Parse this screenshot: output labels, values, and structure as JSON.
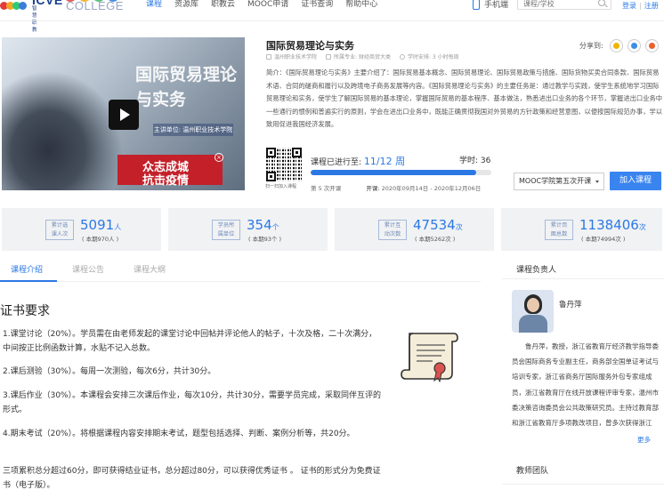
{
  "nav": {
    "logo_text": "ICVE",
    "logo_sub": "智慧职教",
    "college": "COLLEGE",
    "links": [
      "课程",
      "资源库",
      "职教云",
      "MOOC申请",
      "证书查询",
      "帮助中心"
    ],
    "mobile": "手机端",
    "search_placeholder": "课程/学校",
    "login": "登录",
    "register": "注册"
  },
  "course": {
    "title": "国际贸易理论与实务",
    "school": "温州职业技术学院",
    "major": "所属专业: 财经商贸大类",
    "arrangement": "学时安排: 3 小时每周",
    "share_label": "分享到:",
    "intro": "简介：《国际贸易理论与实务》主要介绍了：国际贸易基本概念、国际贸易理论、国际贸易政策与措施、国际货物买卖合同条款、国际贸易术语、合同的磋商和履行以及跨境电子商务发展等内容。《国际贸易理论与实务》的主要任务是：通过教学与实践，使学生系统地学习国际贸易理论和实务，使学生了解国际贸易的基本理论，掌握国际贸易的基本程序、基本做法，熟悉进出口业务的各个环节，掌握进出口业务中一些通行的惯例和普遍实行的原则，学会在进出口业务中，既能正确贯彻我国对外贸易的方针政策和经营意图，以便按国际规范办事，学以致用促进我国经济发展。",
    "cover_title_line1": "国际贸易理论",
    "cover_title_line2": "与实务",
    "cover_school": "主讲单位: 温州职业技术学院",
    "banner_line1": "众志成城",
    "banner_line2": "抗击疫情",
    "qr_caption": "扫一扫加入课程",
    "progress_label": "课程已进行至:",
    "progress_value": "11/12 周",
    "progress_fraction": 0.917,
    "study_hours": "学时: 36",
    "session": "第 5 次开课",
    "dates_label": "开课:",
    "dates": "2020年09月14日 - 2020年12月06日",
    "term_select": "MOOC学院第五次开课",
    "join_button": "加入课程"
  },
  "stats": [
    {
      "tag1": "累计选",
      "tag2": "课人次",
      "value": "5091",
      "unit": "人",
      "sub": "( 本期970人 )"
    },
    {
      "tag1": "学员所",
      "tag2": "属单位",
      "value": "354",
      "unit": "个",
      "sub": "( 本期93个 )"
    },
    {
      "tag1": "累计互",
      "tag2": "动次数",
      "value": "47534",
      "unit": "次",
      "sub": "( 本期5262次 )"
    },
    {
      "tag1": "累计页",
      "tag2": "面总数",
      "value": "1138406",
      "unit": "次",
      "sub": "( 本期74994次 )"
    }
  ],
  "tabs": [
    "课程介绍",
    "课程公告",
    "课程大纲"
  ],
  "certificate": {
    "heading": "证书要求",
    "items": [
      "1.课堂讨论（20%）。学员需在由老师发起的课堂讨论中回帖并评论他人的帖子，十次及格，二十次满分，中间按正比例函数计算，水贴不记入总数。",
      "2.课后测验（30%）。每周一次测验，每次6分，共计30分。",
      "3.课后作业（30%）。本课程会安排三次课后作业，每次10分，共计30分，需要学员完成，采取同伴互评的形式。",
      "4.期末考试（20%）。将根据课程内容安排期末考试，题型包括选择、判断、案例分析等，共20分。",
      "三项累积总分超过60分，即可获得结业证书，总分超过80分，可以获得优秀证书 。 证书的形式分为免费证书（电子版）。"
    ]
  },
  "instructor": {
    "heading": "课程负责人",
    "name": "鲁丹萍",
    "bio": "鲁丹萍，教授，浙江省教育厅经济教学指导委员会国际商务专业副主任，商务部全国单证考试与培训专家，浙江省商务厅国际服务外包专家组成员，浙江省教育厅在线开放课程评审专家，温州市委决策咨询委员会公共政策研究员。主持过教育部和浙江省教育厅多项教改项目，曾多次获得浙江",
    "more": "更多",
    "team_heading": "教师团队"
  },
  "colors": {
    "accent": "#2b78e4",
    "button": "#3a84f0",
    "banner": "#c3202a"
  }
}
